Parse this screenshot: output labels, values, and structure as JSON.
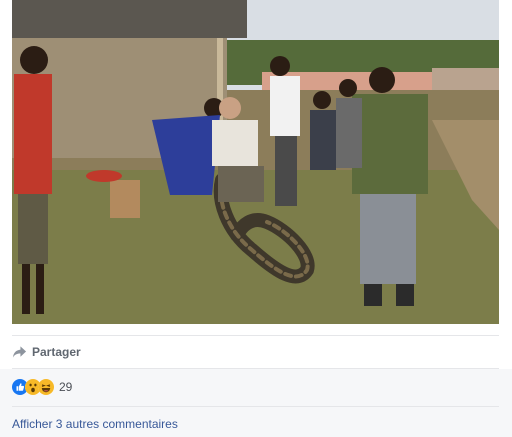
{
  "post": {
    "photo": {
      "icon": "photo-image",
      "colors": {
        "sky": "#d9dee4",
        "ground": "#8c7d5a",
        "grass": "#6f7d3e",
        "building_wall": "#9e8f75",
        "roof": "#5b5750",
        "pink_building": "#d7a08b",
        "python": "#3f382b"
      }
    },
    "actions": {
      "share_label": "Partager",
      "share_icon": "share-arrow-icon"
    },
    "reactions": {
      "icons": [
        "like-icon",
        "wow-icon",
        "haha-icon"
      ],
      "count": "29"
    },
    "comments": {
      "more_label": "Afficher 3 autres commentaires"
    },
    "colors": {
      "link": "#385898",
      "secondary_text": "#606770",
      "like_blue": "#1877f2",
      "emoji_yellow": "#f7b928",
      "comments_bg": "#f6f7f9"
    }
  }
}
